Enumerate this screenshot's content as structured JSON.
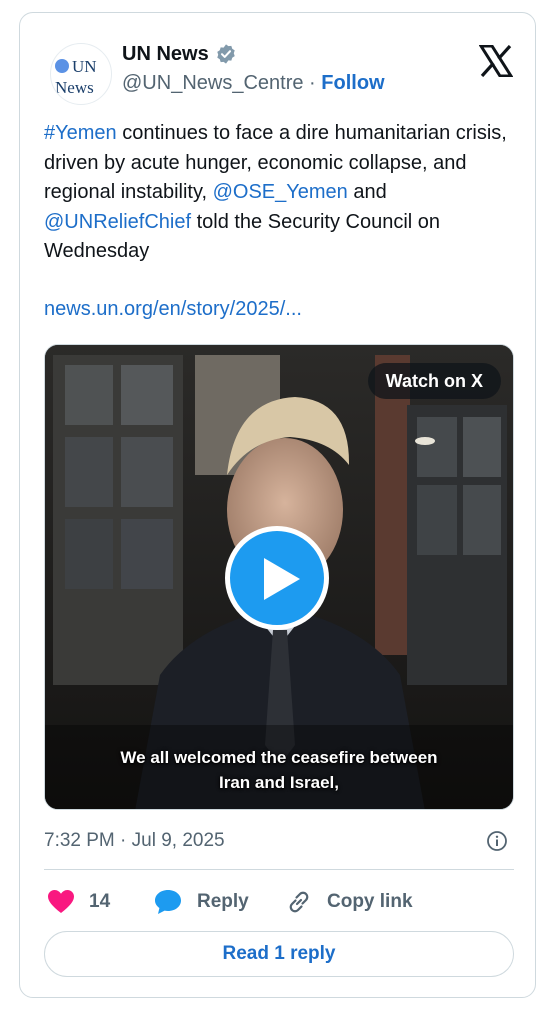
{
  "author": {
    "avatar_text_line1": "UN",
    "avatar_text_line2": "News",
    "display_name": "UN News",
    "handle": "@UN_News_Centre",
    "separator": "·",
    "follow_label": "Follow",
    "verified": true
  },
  "tweet": {
    "hashtag": "#Yemen",
    "text_part1": " continues to face a dire humanitarian crisis, driven by acute hunger, economic collapse, and regional instability, ",
    "mention1": "@OSE_Yemen",
    "text_part2": " and ",
    "mention2": "@UNReliefChief",
    "text_part3": " told the Security Council on Wednesday",
    "url": "news.un.org/en/story/2025/..."
  },
  "video": {
    "watch_label": "Watch on X",
    "caption_line1": "We all welcomed the ceasefire between",
    "caption_line2": "Iran and Israel,"
  },
  "meta": {
    "timestamp": "7:32 PM · Jul 9, 2025"
  },
  "actions": {
    "like_count": "14",
    "reply_label": "Reply",
    "copy_label": "Copy link",
    "read_replies_label": "Read 1 reply"
  },
  "colors": {
    "link": "#1d6ec9",
    "like": "#f91880",
    "reply_icon": "#1d9bf0",
    "muted": "#536471",
    "border": "#cfd9de"
  },
  "icons": [
    "verified-badge-icon",
    "x-logo-icon",
    "play-icon",
    "info-icon",
    "heart-icon",
    "reply-bubble-icon",
    "link-icon"
  ]
}
